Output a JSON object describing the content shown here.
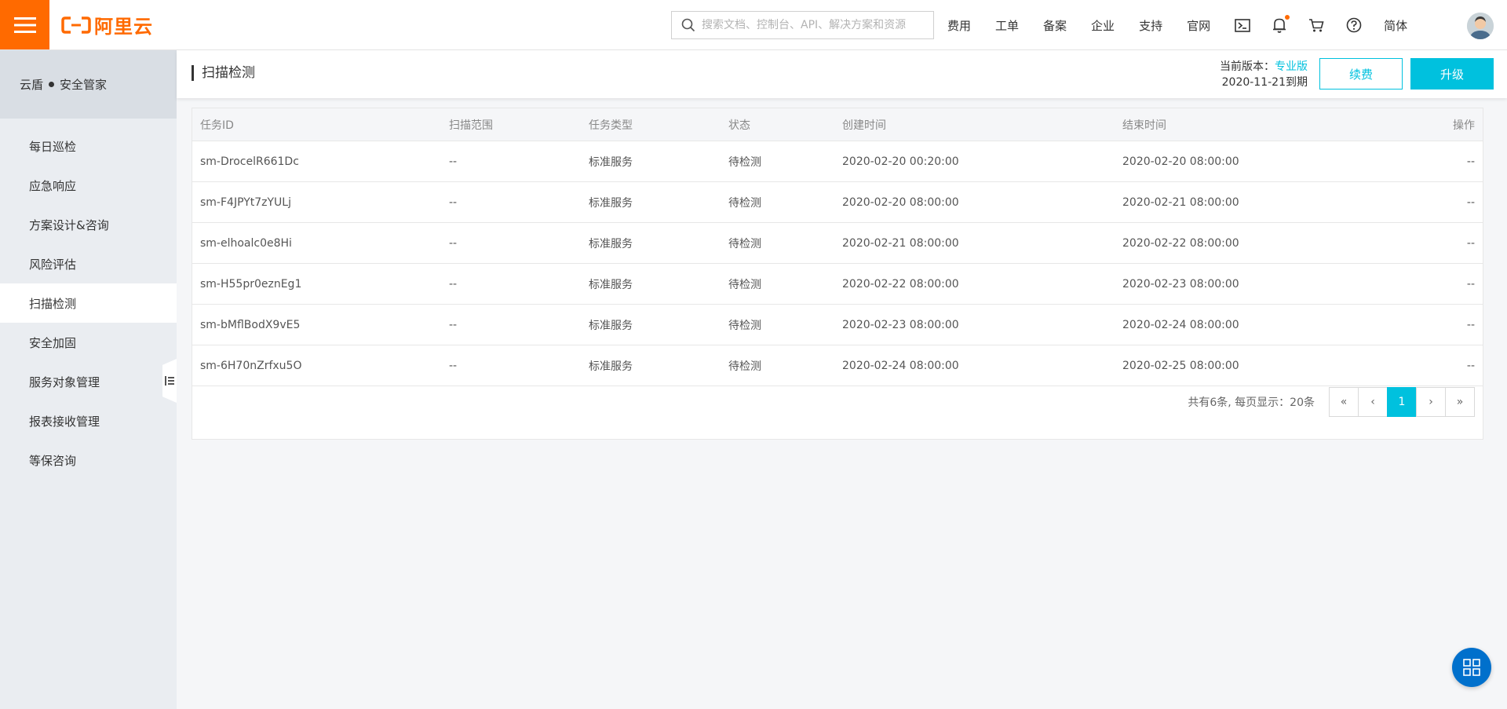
{
  "header": {
    "logo_text": "阿里云",
    "search_placeholder": "搜索文档、控制台、API、解决方案和资源",
    "nav": [
      "费用",
      "工单",
      "备案",
      "企业",
      "支持",
      "官网"
    ],
    "language": "简体"
  },
  "sidebar": {
    "title_left": "云盾",
    "title_right": "安全管家",
    "items": [
      {
        "label": "每日巡检"
      },
      {
        "label": "应急响应"
      },
      {
        "label": "方案设计&咨询"
      },
      {
        "label": "风险评估"
      },
      {
        "label": "扫描检测",
        "active": true
      },
      {
        "label": "安全加固"
      },
      {
        "label": "服务对象管理"
      },
      {
        "label": "报表接收管理"
      },
      {
        "label": "等保咨询"
      }
    ]
  },
  "page": {
    "title": "扫描检测",
    "version_label": "当前版本：",
    "version_name": "专业版",
    "expiry": "2020-11-21到期",
    "renew_label": "续费",
    "upgrade_label": "升级"
  },
  "table": {
    "headers": {
      "id": "任务ID",
      "scope": "扫描范围",
      "type": "任务类型",
      "status": "状态",
      "created": "创建时间",
      "ended": "结束时间",
      "op": "操作"
    },
    "rows": [
      {
        "id": "sm-DrocelR661Dc",
        "scope": "--",
        "type": "标准服务",
        "status": "待检测",
        "created": "2020-02-20 00:20:00",
        "ended": "2020-02-20 08:00:00",
        "op": "--"
      },
      {
        "id": "sm-F4JPYt7zYULj",
        "scope": "--",
        "type": "标准服务",
        "status": "待检测",
        "created": "2020-02-20 08:00:00",
        "ended": "2020-02-21 08:00:00",
        "op": "--"
      },
      {
        "id": "sm-elhoalc0e8Hi",
        "scope": "--",
        "type": "标准服务",
        "status": "待检测",
        "created": "2020-02-21 08:00:00",
        "ended": "2020-02-22 08:00:00",
        "op": "--"
      },
      {
        "id": "sm-H55pr0eznEg1",
        "scope": "--",
        "type": "标准服务",
        "status": "待检测",
        "created": "2020-02-22 08:00:00",
        "ended": "2020-02-23 08:00:00",
        "op": "--"
      },
      {
        "id": "sm-bMflBodX9vE5",
        "scope": "--",
        "type": "标准服务",
        "status": "待检测",
        "created": "2020-02-23 08:00:00",
        "ended": "2020-02-24 08:00:00",
        "op": "--"
      },
      {
        "id": "sm-6H70nZrfxu5O",
        "scope": "--",
        "type": "标准服务",
        "status": "待检测",
        "created": "2020-02-24 08:00:00",
        "ended": "2020-02-25 08:00:00",
        "op": "--"
      }
    ]
  },
  "pagination": {
    "summary": "共有6条, 每页显示：20条",
    "first": "«",
    "prev": "‹",
    "current": "1",
    "next": "›",
    "last": "»"
  },
  "colors": {
    "brand_orange": "#ff6a00",
    "accent_cyan": "#00c1de",
    "float_blue": "#0070cc"
  },
  "icons": [
    "menu-icon",
    "aliyun-logo-icon",
    "search-icon",
    "terminal-icon",
    "bell-icon",
    "cart-icon",
    "help-icon",
    "collapse-sidebar-icon",
    "grid-apps-icon"
  ]
}
